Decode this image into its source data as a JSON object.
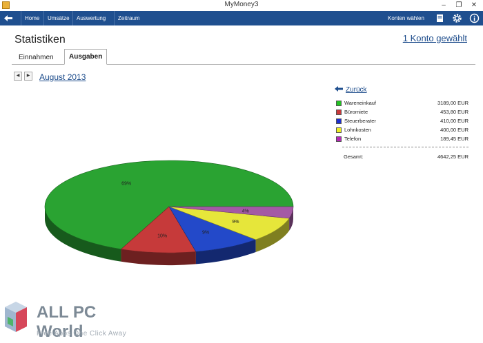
{
  "window": {
    "title": "MyMoney3"
  },
  "menubar": {
    "items": [
      "Home",
      "Umsätze",
      "Auswertung",
      "Zeitraum"
    ],
    "accounts_label": "Konten wählen"
  },
  "page": {
    "title": "Statistiken",
    "account_link": "1 Konto gewählt"
  },
  "tabs": [
    {
      "label": "Einnahmen",
      "active": false
    },
    {
      "label": "Ausgaben",
      "active": true
    }
  ],
  "period": {
    "label": "August 2013"
  },
  "legend": {
    "back_label": "Zurück",
    "items": [
      {
        "name": "Wareneinkauf",
        "value": "3189,00 EUR",
        "color": "#22c322"
      },
      {
        "name": "Büromiete",
        "value": "453,80 EUR",
        "color": "#c9393b"
      },
      {
        "name": "Steuerberater",
        "value": "410,00 EUR",
        "color": "#1d2fcf"
      },
      {
        "name": "Lohnkosten",
        "value": "400,00 EUR",
        "color": "#eeee22"
      },
      {
        "name": "Telefon",
        "value": "189,45 EUR",
        "color": "#b528b5"
      }
    ],
    "total_label": "Gesamt:",
    "total_value": "4642,25 EUR"
  },
  "chart_data": {
    "type": "pie",
    "title": "",
    "slices": [
      {
        "label": "Wareneinkauf",
        "value": 3189.0,
        "percent_label": "69%",
        "color": "#2aa332"
      },
      {
        "label": "Büromiete",
        "value": 453.8,
        "percent_label": "10%",
        "color": "#c63a3a"
      },
      {
        "label": "Steuerberater",
        "value": 410.0,
        "percent_label": "9%",
        "color": "#2349c9"
      },
      {
        "label": "Lohnkosten",
        "value": 400.0,
        "percent_label": "9%",
        "color": "#e6e63a"
      },
      {
        "label": "Telefon",
        "value": 189.45,
        "percent_label": "4%",
        "color": "#a45aa4"
      }
    ]
  },
  "watermark": {
    "title": "ALL PC World",
    "subtitle": "Free Apps One Click Away"
  }
}
